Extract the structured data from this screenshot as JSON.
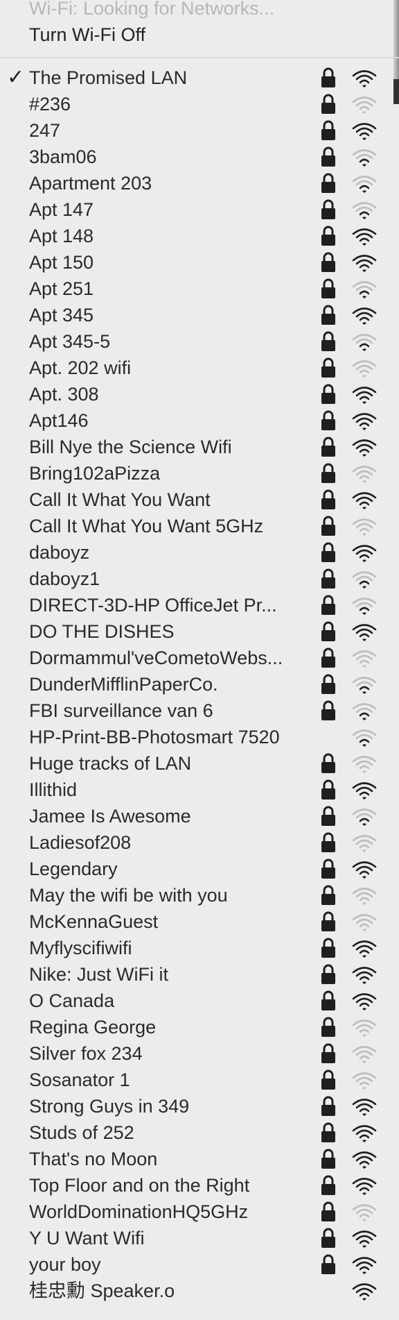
{
  "header": {
    "status": "Wi-Fi: Looking for Networks...",
    "toggle_label": "Turn Wi-Fi Off"
  },
  "colors": {
    "menu_bg": "#ececec",
    "text": "#2a2a2a",
    "dim_text": "#b7b7b7",
    "icon_dark": "#1f1f1f",
    "icon_faint": "#bdbdbd"
  },
  "check_mark": "✓",
  "networks": [
    {
      "name": "The Promised LAN",
      "locked": true,
      "connected": true,
      "signal": 3
    },
    {
      "name": "#236",
      "locked": true,
      "signal": 0
    },
    {
      "name": "247",
      "locked": true,
      "signal": 3
    },
    {
      "name": "3bam06",
      "locked": true,
      "signal": 1
    },
    {
      "name": "Apartment 203",
      "locked": true,
      "signal": 1
    },
    {
      "name": "Apt 147",
      "locked": true,
      "signal": 1
    },
    {
      "name": "Apt 148",
      "locked": true,
      "signal": 3
    },
    {
      "name": "Apt 150",
      "locked": true,
      "signal": 3
    },
    {
      "name": "Apt 251",
      "locked": true,
      "signal": 1
    },
    {
      "name": "Apt 345",
      "locked": true,
      "signal": 3
    },
    {
      "name": "Apt 345-5",
      "locked": true,
      "signal": 1
    },
    {
      "name": "Apt. 202 wifi",
      "locked": true,
      "signal": 0
    },
    {
      "name": "Apt. 308",
      "locked": true,
      "signal": 3
    },
    {
      "name": "Apt146",
      "locked": true,
      "signal": 3
    },
    {
      "name": "Bill Nye the Science Wifi",
      "locked": true,
      "signal": 3
    },
    {
      "name": "Bring102aPizza",
      "locked": true,
      "signal": 0
    },
    {
      "name": "Call It What You Want",
      "locked": true,
      "signal": 3
    },
    {
      "name": "Call It What You Want 5GHz",
      "locked": true,
      "signal": 0
    },
    {
      "name": "daboyz",
      "locked": true,
      "signal": 3
    },
    {
      "name": "daboyz1",
      "locked": true,
      "signal": 1
    },
    {
      "name": "DIRECT-3D-HP OfficeJet Pr...",
      "locked": true,
      "signal": 1
    },
    {
      "name": "DO THE DISHES",
      "locked": true,
      "signal": 3
    },
    {
      "name": "Dormammul'veCometoWebs...",
      "locked": true,
      "signal": 0
    },
    {
      "name": "DunderMifflinPaperCo.",
      "locked": true,
      "signal": 1
    },
    {
      "name": "FBI surveillance van 6",
      "locked": true,
      "signal": 1
    },
    {
      "name": "HP-Print-BB-Photosmart 7520",
      "locked": false,
      "signal": 1
    },
    {
      "name": "Huge tracks of LAN",
      "locked": true,
      "signal": 0
    },
    {
      "name": "Illithid",
      "locked": true,
      "signal": 3
    },
    {
      "name": "Jamee Is Awesome",
      "locked": true,
      "signal": 1
    },
    {
      "name": "Ladiesof208",
      "locked": true,
      "signal": 0
    },
    {
      "name": "Legendary",
      "locked": true,
      "signal": 3
    },
    {
      "name": "May the wifi be with you",
      "locked": true,
      "signal": 0
    },
    {
      "name": "McKennaGuest",
      "locked": true,
      "signal": 0
    },
    {
      "name": "Myflyscifiwifi",
      "locked": true,
      "signal": 3
    },
    {
      "name": "Nike: Just WiFi it",
      "locked": true,
      "signal": 3
    },
    {
      "name": "O Canada",
      "locked": true,
      "signal": 3
    },
    {
      "name": "Regina George",
      "locked": true,
      "signal": 0
    },
    {
      "name": "Silver fox 234",
      "locked": true,
      "signal": 0
    },
    {
      "name": "Sosanator 1",
      "locked": true,
      "signal": 0
    },
    {
      "name": "Strong Guys in 349",
      "locked": true,
      "signal": 3
    },
    {
      "name": "Studs of 252",
      "locked": true,
      "signal": 3
    },
    {
      "name": "That's no Moon",
      "locked": true,
      "signal": 3
    },
    {
      "name": "Top Floor and on the Right",
      "locked": true,
      "signal": 3
    },
    {
      "name": "WorldDominationHQ5GHz",
      "locked": true,
      "signal": 0
    },
    {
      "name": "Y U Want Wifi",
      "locked": true,
      "signal": 3
    },
    {
      "name": "your boy",
      "locked": true,
      "signal": 3
    },
    {
      "name": "桂忠勳 Speaker.o",
      "locked": false,
      "signal": 3
    }
  ]
}
